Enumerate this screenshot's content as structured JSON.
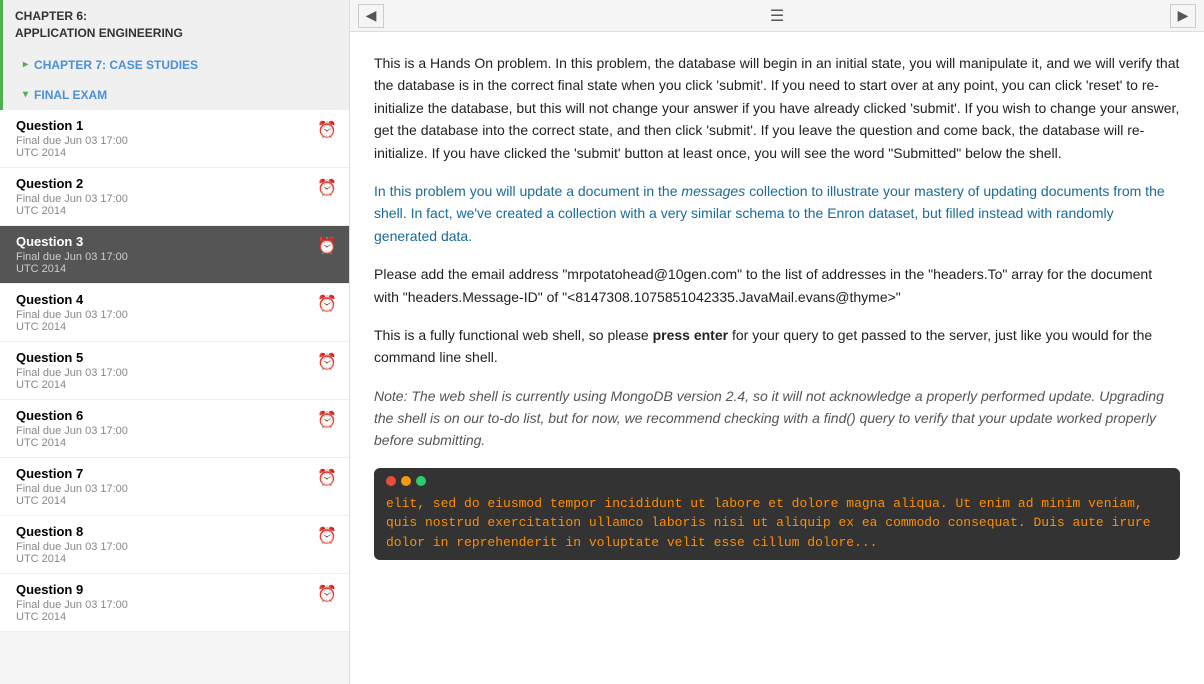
{
  "sidebar": {
    "chapter6": {
      "line1": "CHAPTER 6:",
      "line2": "APPLICATION ENGINEERING"
    },
    "chapter7": {
      "label": "CHAPTER 7: CASE STUDIES"
    },
    "finalExam": {
      "label": "FINAL EXAM"
    },
    "questions": [
      {
        "id": 1,
        "title": "Question 1",
        "due": "Final due Jun 03 17:00\nUTC 2014",
        "active": false
      },
      {
        "id": 2,
        "title": "Question 2",
        "due": "Final due Jun 03 17:00\nUTC 2014",
        "active": false
      },
      {
        "id": 3,
        "title": "Question 3",
        "due": "Final due Jun 03 17:00\nUTC 2014",
        "active": true
      },
      {
        "id": 4,
        "title": "Question 4",
        "due": "Final due Jun 03 17:00\nUTC 2014",
        "active": false
      },
      {
        "id": 5,
        "title": "Question 5",
        "due": "Final due Jun 03 17:00\nUTC 2014",
        "active": false
      },
      {
        "id": 6,
        "title": "Question 6",
        "due": "Final due Jun 03 17:00\nUTC 2014",
        "active": false
      },
      {
        "id": 7,
        "title": "Question 7",
        "due": "Final due Jun 03 17:00\nUTC 2014",
        "active": false
      },
      {
        "id": 8,
        "title": "Question 8",
        "due": "Final due Jun 03 17:00\nUTC 2014",
        "active": false
      },
      {
        "id": 9,
        "title": "Question 9",
        "due": "Final due Jun 03 17:00\nUTC 2014",
        "active": false
      }
    ]
  },
  "main": {
    "paragraph1": "This is a Hands On problem. In this problem, the database will begin in an initial state, you will manipulate it, and we will verify that the database is in the correct final state when you click 'submit'. If you need to start over at any point, you can click 'reset' to re-initialize the database, but this will not change your answer if you have already clicked 'submit'. If you wish to change your answer, get the database into the correct state, and then click 'submit'. If you leave the question and come back, the database will re-initialize. If you have clicked the 'submit' button at least once, you will see the word \"Submitted\" below the shell.",
    "paragraph2": "In this problem you will update a document in the messages collection to illustrate your mastery of updating documents from the shell. In fact, we've created a collection with a very similar schema to the Enron dataset, but filled instead with randomly generated data.",
    "paragraph2_italic_part": "messages",
    "paragraph3": "Please add the email address \"mrpotatohead@10gen.com\" to the list of addresses in the \"headers.To\" array for the document with \"headers.Message-ID\" of \"<8147308.1075851042335.JavaMail.evans@thyme>\"",
    "paragraph4_start": "This is a fully functional web shell, so please ",
    "paragraph4_bold": "press enter",
    "paragraph4_end": " for your query to get passed to the server, just like you would for the command line shell.",
    "paragraph5": "Note: The web shell is currently using MongoDB version 2.4, so it will not acknowledge a properly performed update. Upgrading the shell is on our to-do list, but for now, we recommend checking with a find() query to verify that your update worked properly before submitting.",
    "shell_text": "elit, sed do eiusmod tempor incididunt ut labore et dolore magna aliqua. Ut enim ad minim veniam, quis nostrud exercitation ullamco laboris nisi ut aliquip ex ea commodo consequat. Duis aute irure dolor in reprehenderit in voluptate velit esse cillum dolore..."
  }
}
